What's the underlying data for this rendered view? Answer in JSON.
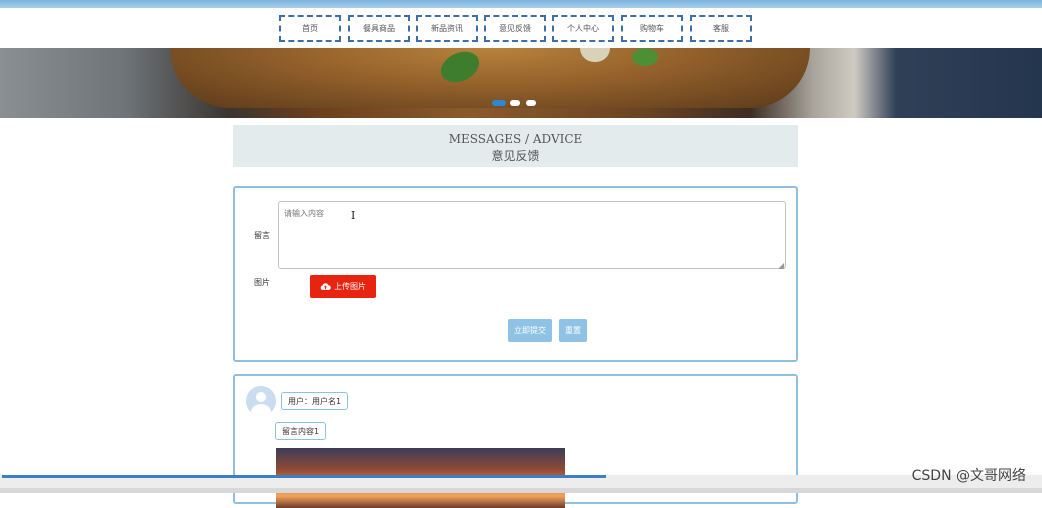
{
  "nav": {
    "items": [
      "首页",
      "餐具商品",
      "新品资讯",
      "意见反馈",
      "个人中心",
      "购物车",
      "客服"
    ]
  },
  "banner": {
    "slides": 3,
    "active_slide": 1
  },
  "section": {
    "title_en": "MESSAGES / ADVICE",
    "title_cn": "意见反馈"
  },
  "form": {
    "message_label": "留言",
    "message_placeholder": "请输入内容",
    "image_label": "图片",
    "upload_label": "上传图片",
    "submit_label": "立即提交",
    "reset_label": "重置"
  },
  "messages": [
    {
      "user": "用户：用户名1",
      "content": "留言内容1"
    }
  ],
  "watermark": "CSDN @文哥网络",
  "colors": {
    "accent_blue": "#8fbfe3",
    "nav_border": "#3c6fa8",
    "upload_red": "#e8230f",
    "button_blue": "#8fc3e6"
  }
}
